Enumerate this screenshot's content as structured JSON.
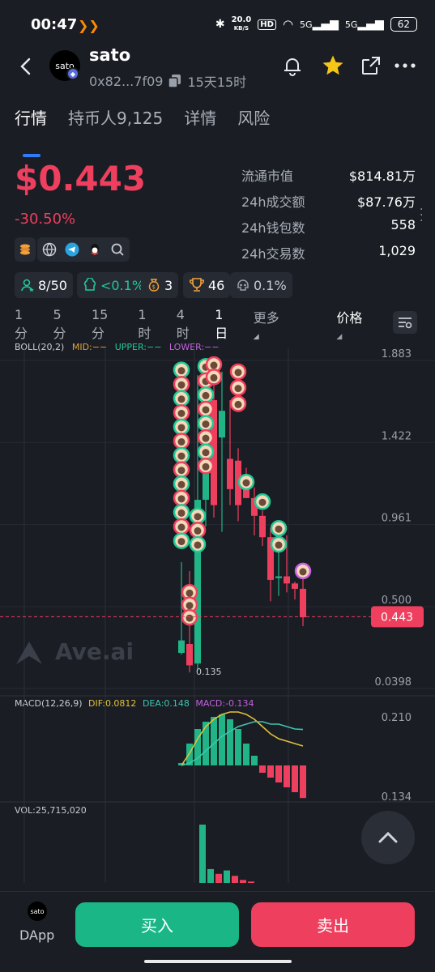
{
  "status_bar": {
    "time": "00:47",
    "net_speed_value": "20.0",
    "net_speed_unit": "KB/S",
    "hd": "HD",
    "signal1": "5G",
    "signal2": "5G",
    "battery": "62"
  },
  "header": {
    "avatar_text": "sato",
    "chain_badge": "◆",
    "token_name": "sato",
    "address": "0x82...7f09",
    "age": "15天15时"
  },
  "tabs": [
    {
      "label": "行情",
      "active": true
    },
    {
      "label": "持币人9,125",
      "active": false
    },
    {
      "label": "详情",
      "active": false
    },
    {
      "label": "风险",
      "active": false
    }
  ],
  "price": {
    "value": "$0.443",
    "change": "-30.50%"
  },
  "stats": [
    {
      "label": "流通市值",
      "value": "$814.81万"
    },
    {
      "label": "24h成交额",
      "value": "$87.76万"
    },
    {
      "label": "24h钱包数",
      "value": "558"
    },
    {
      "label": "24h交易数",
      "value": "1,029"
    }
  ],
  "chips": {
    "holders": "8/50",
    "top10": "<0.1%",
    "bag": "3",
    "trophy": "46",
    "skull": "0.1%"
  },
  "timeframes": [
    {
      "label": "1分",
      "active": false
    },
    {
      "label": "5分",
      "active": false
    },
    {
      "label": "15分",
      "active": false
    },
    {
      "label": "1时",
      "active": false
    },
    {
      "label": "4时",
      "active": false
    },
    {
      "label": "1日",
      "active": true
    },
    {
      "label": "更多",
      "active": false
    },
    {
      "label": "价格",
      "active": false
    }
  ],
  "boll": {
    "label": "BOLL(20,2)",
    "mid": "MID:−−",
    "upper": "UPPER:−−",
    "lower": "LOWER:−−"
  },
  "macd_labels": {
    "label": "MACD(12,26,9)",
    "dif": "DIF:0.0812",
    "dea": "DEA:0.148",
    "macd": "MACD:-0.134"
  },
  "vol_label": "VOL:25,715,020",
  "watermark": "Ave.ai",
  "colors": {
    "up": "#20b486",
    "down": "#ef3f5e",
    "boll_mid": "#e0a43a",
    "boll_upper": "#20c997",
    "boll_lower": "#c661e0",
    "dif": "#e0c23a",
    "dea": "#3ec6b0",
    "accent": "#2f7cf6"
  },
  "chart_data": {
    "type": "candlestick",
    "price_axis": {
      "ticks": [
        "1.883",
        "1.422",
        "0.961",
        "0.500",
        "0.0398"
      ],
      "range": [
        0.0398,
        1.883
      ],
      "current_label": "0.443",
      "low_label": "0.135"
    },
    "candles": [
      {
        "o": 0.24,
        "h": 0.75,
        "l": 0.23,
        "c": 0.31
      },
      {
        "o": 0.29,
        "h": 0.7,
        "l": 0.13,
        "c": 0.17
      },
      {
        "o": 0.18,
        "h": 1.8,
        "l": 0.14,
        "c": 1.1
      },
      {
        "o": 1.1,
        "h": 1.86,
        "l": 0.95,
        "c": 1.66
      },
      {
        "o": 1.66,
        "h": 1.88,
        "l": 1.0,
        "c": 1.07
      },
      {
        "o": 1.45,
        "h": 1.82,
        "l": 0.92,
        "c": 1.6
      },
      {
        "o": 1.33,
        "h": 1.66,
        "l": 1.07,
        "c": 1.16
      },
      {
        "o": 1.32,
        "h": 1.39,
        "l": 0.98,
        "c": 1.07
      },
      {
        "o": 1.16,
        "h": 1.28,
        "l": 1.11,
        "c": 1.11
      },
      {
        "o": 1.11,
        "h": 1.17,
        "l": 0.9,
        "c": 1.01
      },
      {
        "o": 1.01,
        "h": 1.04,
        "l": 0.84,
        "c": 0.89
      },
      {
        "o": 0.89,
        "h": 0.94,
        "l": 0.53,
        "c": 0.65
      },
      {
        "o": 0.66,
        "h": 0.84,
        "l": 0.56,
        "c": 0.67
      },
      {
        "o": 0.67,
        "h": 0.9,
        "l": 0.58,
        "c": 0.63
      },
      {
        "o": 0.63,
        "h": 0.64,
        "l": 0.54,
        "c": 0.6
      },
      {
        "o": 0.6,
        "h": 0.67,
        "l": 0.39,
        "c": 0.44
      }
    ],
    "macd": {
      "axis_ticks": [
        "0.210",
        "0.134"
      ],
      "histogram": [
        0.01,
        0.09,
        0.15,
        0.18,
        0.2,
        0.21,
        0.19,
        0.15,
        0.09,
        0.04,
        -0.03,
        -0.05,
        -0.07,
        -0.09,
        -0.11,
        -0.134
      ],
      "dif": [
        0.0,
        0.05,
        0.11,
        0.16,
        0.19,
        0.21,
        0.22,
        0.22,
        0.21,
        0.19,
        0.16,
        0.13,
        0.11,
        0.1,
        0.09,
        0.08
      ],
      "dea": [
        0.0,
        0.01,
        0.03,
        0.06,
        0.09,
        0.12,
        0.14,
        0.16,
        0.17,
        0.18,
        0.18,
        0.17,
        0.17,
        0.16,
        0.15,
        0.148
      ]
    },
    "volume": {
      "values": [
        0,
        0,
        25.7,
        6.1,
        4.0,
        5.5,
        3.1,
        1.3,
        0.6,
        0,
        0,
        0,
        0,
        0,
        0,
        0
      ]
    }
  }
}
